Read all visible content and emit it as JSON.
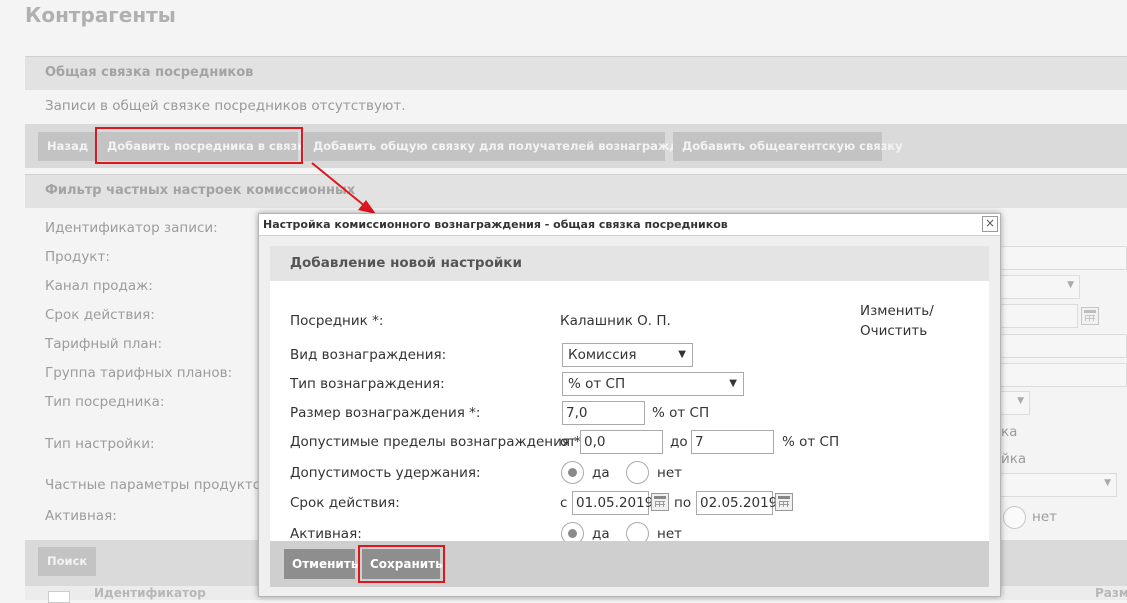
{
  "page": {
    "title": "Контрагенты"
  },
  "common_link": {
    "header": "Общая связка посредников",
    "empty_message": "Записи в общей связке посредников отсутствуют.",
    "buttons": {
      "back": "Назад",
      "add_intermediary": "Добавить посредника в связку",
      "add_common_link": "Добавить общую связку для получателей вознаграждения",
      "add_agency_link": "Добавить общеагентскую связку"
    }
  },
  "filter": {
    "header": "Фильтр частных настроек комиссионных",
    "labels": [
      "Идентификатор записи:",
      "Продукт:",
      "Канал продаж:",
      "Срок действия:",
      "Тарифный план:",
      "Группа тарифных планов:",
      "Тип посредника:",
      "Тип настройки:",
      "Частные параметры продуктов:",
      "Активная:"
    ],
    "partial": {
      "tip1": "ка",
      "tip2": "йка",
      "active_no": "нет"
    },
    "search_button": "Поиск"
  },
  "grid": {
    "col_id": "Идентификатор",
    "col_size": "Разм"
  },
  "dialog": {
    "title": "Настройка комиссионного вознаграждения - общая связка посредников",
    "close_glyph": "×",
    "section_title": "Добавление новой настройки",
    "intermediary": {
      "label": "Посредник *:",
      "value": "Калашник О. П.",
      "edit_link": "Изменить/",
      "clear_link": "Очистить"
    },
    "reward_kind": {
      "label": "Вид вознаграждения:",
      "value": "Комиссия"
    },
    "reward_type": {
      "label": "Тип вознаграждения:",
      "value": "% от СП"
    },
    "reward_size": {
      "label": "Размер вознаграждения *:",
      "value": "7,0",
      "unit": "% от СП"
    },
    "limits": {
      "label": "Допустимые пределы вознаграждения *:",
      "from_label": "от",
      "from_value": "0,0",
      "to_label": "до",
      "to_value": "7",
      "unit": "% от СП"
    },
    "retention": {
      "label": "Допустимость удержания:",
      "yes": "да",
      "no": "нет",
      "selected": "да"
    },
    "validity": {
      "label": "Срок действия:",
      "from_label": "с",
      "from_value": "01.05.2019",
      "to_label": "по",
      "to_value": "02.05.2019"
    },
    "active": {
      "label": "Активная:",
      "yes": "да",
      "no": "нет",
      "selected": "да"
    },
    "buttons": {
      "cancel": "Отменить",
      "save": "Сохранить"
    }
  },
  "colors": {
    "highlight": "#e0161e",
    "arrow": "#e0161e"
  }
}
